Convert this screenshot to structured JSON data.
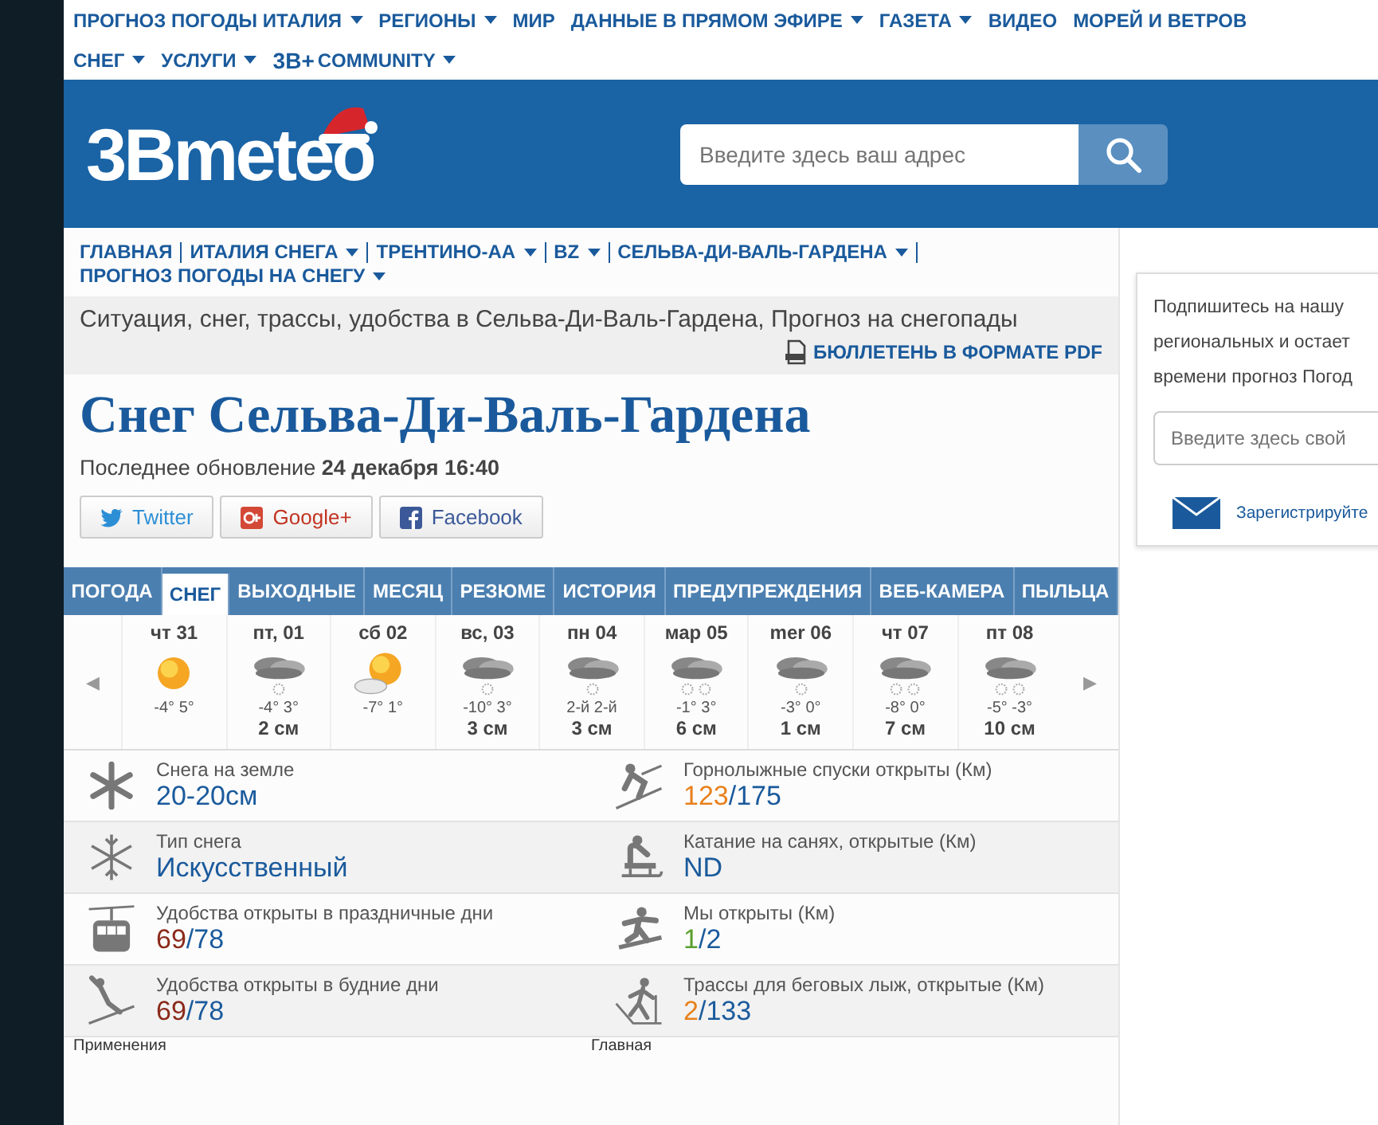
{
  "top_nav": {
    "items": [
      {
        "label": "ПРОГНОЗ ПОГОДЫ ИТАЛИЯ",
        "dropdown": true
      },
      {
        "label": "РЕГИОНЫ",
        "dropdown": true
      },
      {
        "label": "МИР",
        "dropdown": false
      },
      {
        "label": "ДАННЫЕ В ПРЯМОМ ЭФИРЕ",
        "dropdown": true
      },
      {
        "label": "ГАЗЕТА",
        "dropdown": true
      },
      {
        "label": "ВИДЕО",
        "dropdown": false
      },
      {
        "label": "МОРЕЙ И ВЕТРОВ",
        "dropdown": false
      },
      {
        "label": "СНЕГ",
        "dropdown": true
      },
      {
        "label": "УСЛУГИ",
        "dropdown": true
      },
      {
        "label": "COMMUNITY",
        "dropdown": true,
        "logo": "3B+"
      }
    ]
  },
  "header": {
    "logo": "3Bmeteo",
    "search": {
      "placeholder": "Введите здесь ваш адрес"
    }
  },
  "breadcrumbs": [
    {
      "label": "ГЛАВНАЯ",
      "dropdown": false
    },
    {
      "label": "ИТАЛИЯ СНЕГА",
      "dropdown": true
    },
    {
      "label": "ТРЕНТИНО-АА",
      "dropdown": true
    },
    {
      "label": "BZ",
      "dropdown": true
    },
    {
      "label": "СЕЛЬВА-ДИ-ВАЛЬ-ГАРДЕНА",
      "dropdown": true
    },
    {
      "label": "ПРОГНОЗ ПОГОДЫ НА СНЕГУ",
      "dropdown": true
    }
  ],
  "subtitle": "Ситуация, снег, трассы, удобства в Сельва-Ди-Валь-Гардена, Прогноз на снегопады",
  "pdf_link": "БЮЛЛЕТЕНЬ В ФОРМАТЕ PDF",
  "title": "Снег Сельва-Ди-Валь-Гардена",
  "updated": "Последнее обновление **24 декабря 16:40**",
  "social": [
    {
      "kind": "twitter",
      "label": "Twitter"
    },
    {
      "kind": "google",
      "label": "Google+"
    },
    {
      "kind": "facebook",
      "label": "Facebook"
    }
  ],
  "tabs": [
    {
      "label": "ПОГОДА",
      "selected": false
    },
    {
      "label": "СНЕГ",
      "selected": true
    },
    {
      "label": "ВЫХОДНЫЕ",
      "selected": false
    },
    {
      "label": "МЕСЯЦ",
      "selected": false
    },
    {
      "label": "РЕЗЮМЕ",
      "selected": false
    },
    {
      "label": "ИСТОРИЯ",
      "selected": false
    },
    {
      "label": "ПРЕДУПРЕЖДЕНИЯ",
      "selected": false
    },
    {
      "label": "ВЕБ-КАМЕРА",
      "selected": false
    },
    {
      "label": "ПЫЛЬЦА",
      "selected": false
    }
  ],
  "forecast": {
    "prev": "◀",
    "next": "▶",
    "days": [
      {
        "day": "чт 31",
        "kind": "sun",
        "temps": "-4° 5°"
      },
      {
        "day": "пт, 01",
        "kind": "snow",
        "temps": "-4° 3°",
        "snow": "2 см"
      },
      {
        "day": "сб 02",
        "kind": "partly",
        "temps": "-7° 1°"
      },
      {
        "day": "вс, 03",
        "kind": "snow",
        "temps": "-10° 3°",
        "snow": "3 см"
      },
      {
        "day": "пн 04",
        "kind": "snow",
        "temps": "2-й 2-й",
        "snow": "3 см"
      },
      {
        "day": "мар 05",
        "kind": "heavy",
        "temps": "-1° 3°",
        "snow": "6 см"
      },
      {
        "day": "mer 06",
        "kind": "snow",
        "temps": "-3° 0°",
        "snow": "1 см"
      },
      {
        "day": "чт 07",
        "kind": "heavy",
        "temps": "-8° 0°",
        "snow": "7 см"
      },
      {
        "day": "пт 08",
        "kind": "heavy",
        "temps": "-5° -3°",
        "snow": "10 см"
      }
    ]
  },
  "stats": [
    {
      "label": "Снега на земле",
      "value": "20-20см"
    },
    {
      "label": "Горнолыжные спуски открыты (Км)",
      "open": "123",
      "total": "/175",
      "color": "#e8801c"
    },
    {
      "label": "Тип снега",
      "value": "Искусственный"
    },
    {
      "label": "Катание на санях, открытые (Км)",
      "value": "ND"
    },
    {
      "label": "Удобства открыты в праздничные дни",
      "open": "69",
      "total": "/78",
      "color": "#8b2a1a"
    },
    {
      "label": "Мы открыты (Км)",
      "open": "1",
      "total": "/2",
      "color": "#5aa02c"
    },
    {
      "label": "Удобства открыты в будние дни",
      "open": "69",
      "total": "/78",
      "color": "#8b2a1a"
    },
    {
      "label": "Трассы для беговых лыж, открытые (Км)",
      "open": "2",
      "total": "/133",
      "color": "#e8801c"
    }
  ],
  "footer_labels": [
    "Применения",
    "Главная"
  ],
  "sidebar": {
    "lines": [
      "Подпишитесь на нашу",
      "региональных и остает",
      "времени прогноз Погод"
    ],
    "input_placeholder": "Введите здесь свой",
    "register_link": "Зарегистрируйте"
  }
}
